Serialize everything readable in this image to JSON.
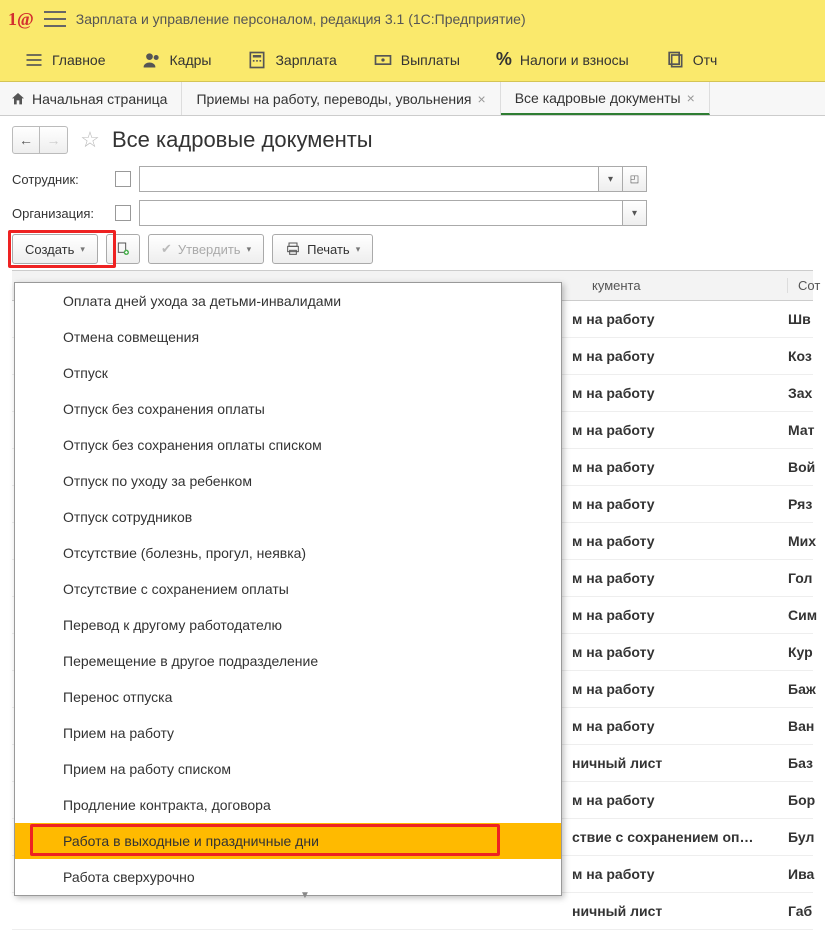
{
  "app": {
    "title": "Зарплата и управление персоналом, редакция 3.1  (1С:Предприятие)"
  },
  "nav": {
    "items": [
      {
        "label": "Главное",
        "icon": "list"
      },
      {
        "label": "Кадры",
        "icon": "people"
      },
      {
        "label": "Зарплата",
        "icon": "calc"
      },
      {
        "label": "Выплаты",
        "icon": "money"
      },
      {
        "label": "Налоги и взносы",
        "icon": "percent"
      },
      {
        "label": "Отч",
        "icon": "copy"
      }
    ]
  },
  "tabs": {
    "home": "Начальная страница",
    "items": [
      {
        "label": "Приемы на работу, переводы, увольнения"
      },
      {
        "label": "Все кадровые документы",
        "active": true
      }
    ]
  },
  "page": {
    "title": "Все кадровые документы"
  },
  "filters": {
    "employee_label": "Сотрудник:",
    "org_label": "Организация:"
  },
  "toolbar": {
    "create": "Создать",
    "approve": "Утвердить",
    "print": "Печать"
  },
  "dropdown": {
    "items": [
      "Оплата дней ухода за детьми-инвалидами",
      "Отмена совмещения",
      "Отпуск",
      "Отпуск без сохранения оплаты",
      "Отпуск без сохранения оплаты списком",
      "Отпуск по уходу за ребенком",
      "Отпуск сотрудников",
      "Отсутствие (болезнь, прогул, неявка)",
      "Отсутствие с сохранением оплаты",
      "Перевод к другому работодателю",
      "Перемещение в другое подразделение",
      "Перенос отпуска",
      "Прием на работу",
      "Прием на работу списком",
      "Продление контракта, договора",
      "Работа в выходные и праздничные дни",
      "Работа сверхурочно"
    ],
    "selected_index": 15
  },
  "table": {
    "header_doc": "кумента",
    "header_emp": "Сот",
    "rows": [
      {
        "doc": "м на работу",
        "emp": "Шв"
      },
      {
        "doc": "м на работу",
        "emp": "Коз"
      },
      {
        "doc": "м на работу",
        "emp": "Зах"
      },
      {
        "doc": "м на работу",
        "emp": "Мат"
      },
      {
        "doc": "м на работу",
        "emp": "Вой"
      },
      {
        "doc": "м на работу",
        "emp": "Ряз"
      },
      {
        "doc": "м на работу",
        "emp": "Мих"
      },
      {
        "doc": "м на работу",
        "emp": "Гол"
      },
      {
        "doc": "м на работу",
        "emp": "Сим"
      },
      {
        "doc": "м на работу",
        "emp": "Кур"
      },
      {
        "doc": "м на работу",
        "emp": "Баж"
      },
      {
        "doc": "м на работу",
        "emp": "Ван"
      },
      {
        "doc": "ничный лист",
        "emp": "Баз"
      },
      {
        "doc": "м на работу",
        "emp": "Бор"
      },
      {
        "doc": "ствие с сохранением оп…",
        "emp": "Бул"
      },
      {
        "doc": "м на работу",
        "emp": "Ива"
      },
      {
        "doc": "ничный лист",
        "emp": "Габ"
      }
    ]
  }
}
